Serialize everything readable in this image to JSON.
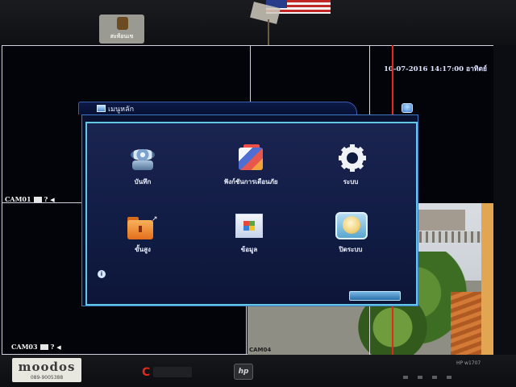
{
  "monitor": {
    "sticker_text": "สะท้อนเข",
    "brand_name": "moodos",
    "brand_phone": "089-9005388",
    "c_logo": "C",
    "hp_logo": "hp",
    "model": "HP w1707"
  },
  "osd": {
    "datetime": "10-07-2016 14:17:00 อาทิตย์",
    "cam01": "CAM01",
    "cam03": "CAM03",
    "feed_stamp": "CAM04"
  },
  "dialog": {
    "title": "เมนูหลัก",
    "items": [
      {
        "label": "บันทึก",
        "icon": "record-icon"
      },
      {
        "label": "ฟังก์ชันการเตือนภัย",
        "icon": "alarm-icon"
      },
      {
        "label": "ระบบ",
        "icon": "gear-icon"
      },
      {
        "label": "ขั้นสูง",
        "icon": "folder-icon"
      },
      {
        "label": "ข้อมูล",
        "icon": "info-icon"
      },
      {
        "label": "ปิดระบบ",
        "icon": "shutdown-icon"
      }
    ],
    "info_glyph": "i"
  },
  "colors": {
    "dialog_border": "#62c7e6",
    "dialog_bg": "#1a2450",
    "red_line": "#e8261d"
  }
}
